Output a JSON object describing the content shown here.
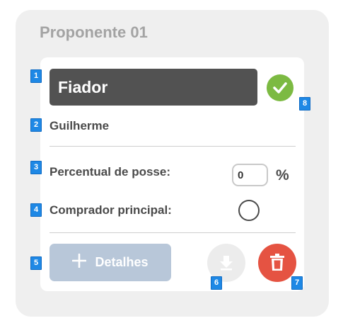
{
  "section_title": "Proponente 01",
  "role": {
    "value": "Fiador",
    "status": "verified"
  },
  "person_name": "Guilherme",
  "ownership": {
    "label": "Percentual de posse:",
    "value": "0",
    "unit": "%"
  },
  "main_buyer": {
    "label": "Comprador principal:",
    "checked": false
  },
  "actions": {
    "details_label": "Detalhes"
  },
  "badges": [
    "1",
    "2",
    "3",
    "4",
    "5",
    "6",
    "7",
    "8"
  ],
  "colors": {
    "role_bg": "#525252",
    "check_green": "#7cba42",
    "details_bg": "#b8c7d9",
    "delete_red": "#e55342",
    "download_bg": "#ececec",
    "badge_blue": "#1e88e5"
  },
  "icons": [
    "check-icon",
    "plus-icon",
    "download-icon",
    "trash-icon"
  ]
}
